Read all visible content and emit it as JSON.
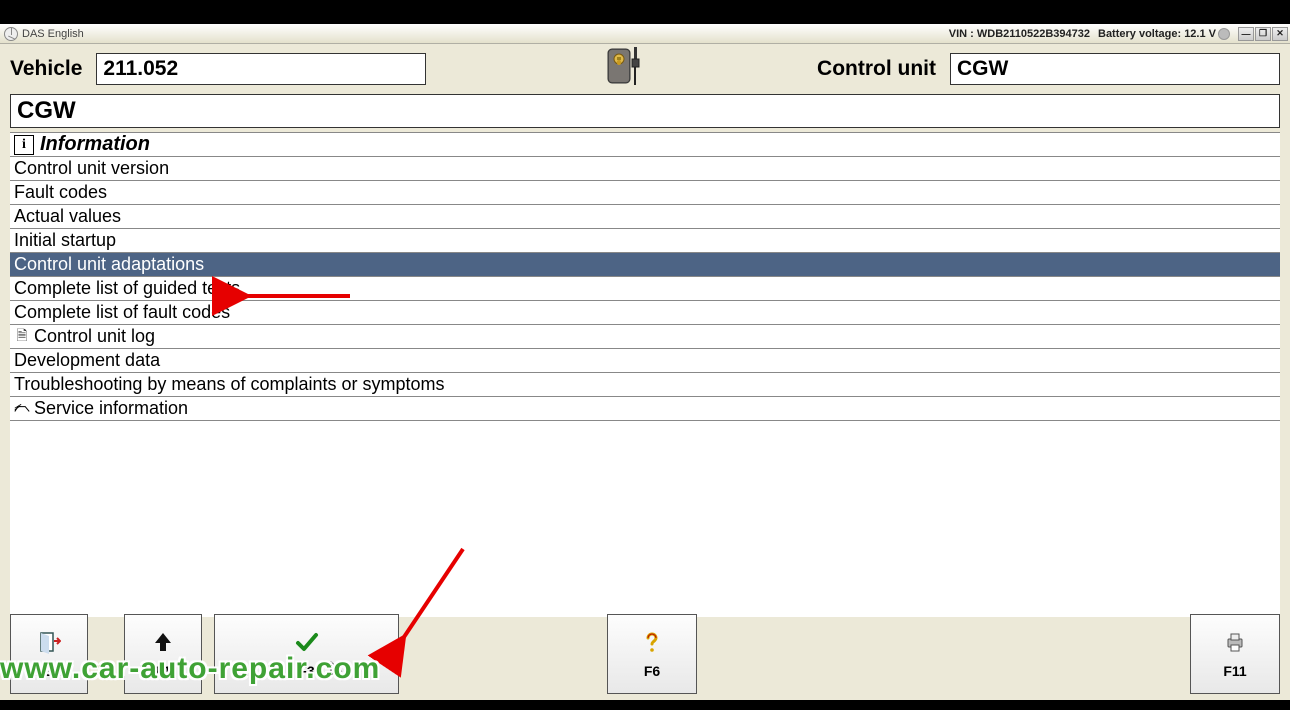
{
  "titlebar": {
    "app_title": "DAS English",
    "vin_label": "VIN : WDB2110522B394732",
    "battery_label": "Battery voltage: 12.1 V"
  },
  "header": {
    "vehicle_label": "Vehicle",
    "vehicle_value": "211.052",
    "control_unit_label": "Control unit",
    "control_unit_value": "CGW"
  },
  "section_title": "CGW",
  "menu": {
    "header_label": "Information",
    "items": [
      {
        "label": "Control unit version",
        "selected": false
      },
      {
        "label": "Fault codes",
        "selected": false
      },
      {
        "label": "Actual values",
        "selected": false
      },
      {
        "label": "Initial startup",
        "selected": false
      },
      {
        "label": "Control unit adaptations",
        "selected": true
      },
      {
        "label": "Complete list of guided tests",
        "selected": false
      },
      {
        "label": "Complete list of fault codes",
        "selected": false
      },
      {
        "label": "Control unit log",
        "selected": false,
        "icon": "doc"
      },
      {
        "label": "Development data",
        "selected": false
      },
      {
        "label": "Troubleshooting by means of complaints or symptoms",
        "selected": false
      },
      {
        "label": "Service information",
        "selected": false,
        "icon": "car",
        "indent": true
      }
    ]
  },
  "fn": {
    "esc": "ESC",
    "f1": "F1",
    "f3": "F3",
    "f6": "F6",
    "f11": "F11"
  },
  "watermark": "www.car-auto-repair.com",
  "annotations": {
    "arrow1_target": "Control unit adaptations",
    "arrow2_target": "F3 confirm button"
  }
}
